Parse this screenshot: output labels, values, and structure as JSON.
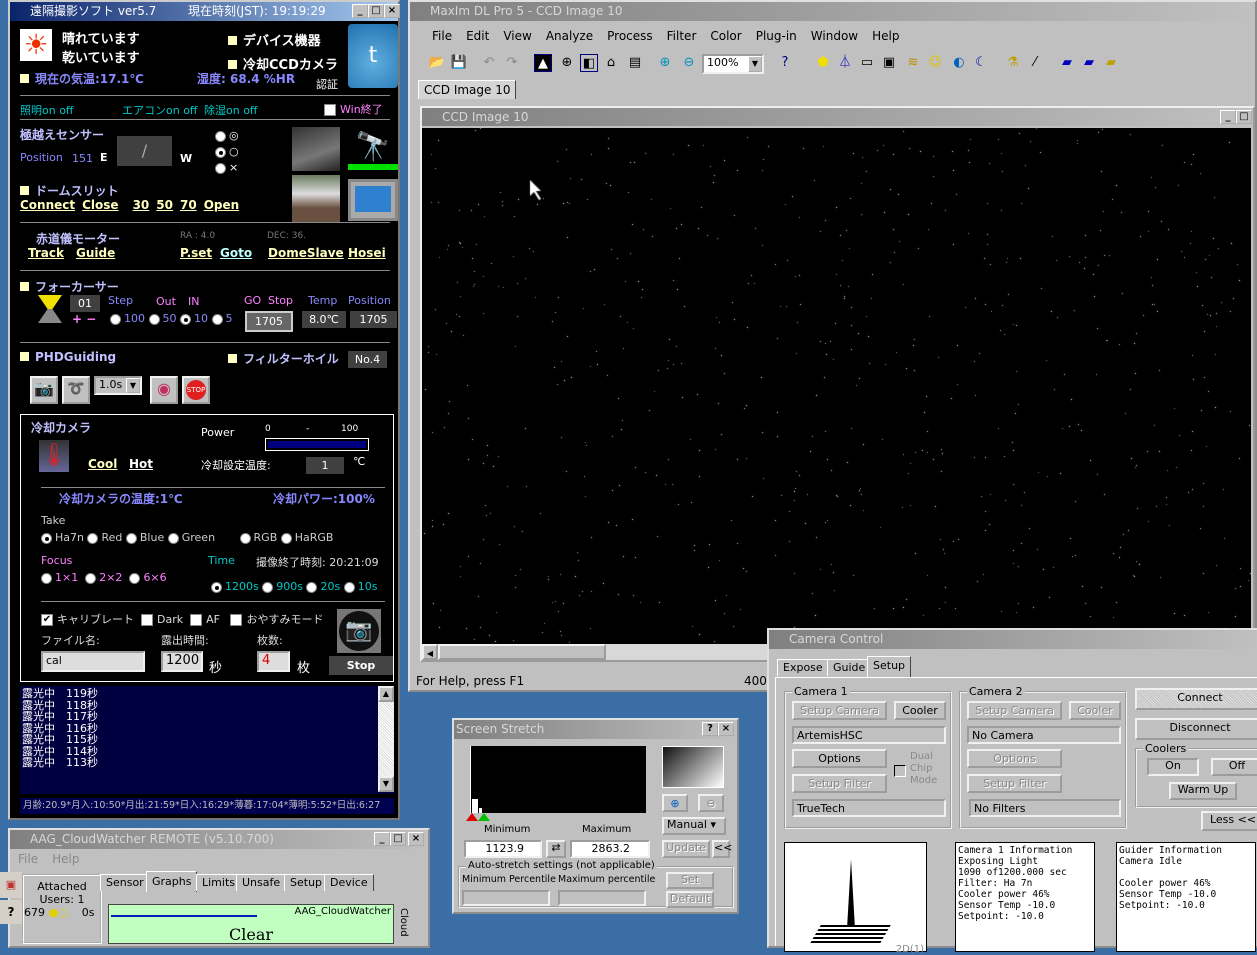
{
  "left_app": {
    "title": "遠隔撮影ソフト ver5.7",
    "clock": "現在時刻(JST): 19:19:29",
    "weather1": "晴れています",
    "weather2": "乾いています",
    "device": "デバイス機器",
    "ccd": "冷却CCDカメラ",
    "temp": "現在の気温:17.1℃",
    "humidity": "湿度: 68.4 %HR",
    "auth": "認証",
    "light": "照明on off",
    "aircon": "エアコンon  off",
    "dehumid": "除湿on off",
    "win_exit": "Win終了",
    "meridian_sensor": "極越えセンサー",
    "position_label": "Position",
    "position_value": "151",
    "east": "E",
    "west": "W",
    "sym1": "◎",
    "sym2": "○",
    "sym3": "×",
    "dome_slit": "ドームスリット",
    "dome_links": [
      "Connect",
      "Close",
      "30",
      "50",
      "70",
      "Open"
    ],
    "mount": "赤道儀モーター",
    "ra": "RA : 4.0",
    "dec": "DEC: 36.",
    "mount_links": [
      "Track",
      "Guide",
      "P.set",
      "Goto",
      "DomeSlave",
      "Hosei"
    ],
    "focuser": "フォーカーサー",
    "focus_id": "01",
    "step": "Step",
    "out": "Out",
    "in": "IN",
    "plusminus": "+ −",
    "steps": [
      "100",
      "50",
      "10",
      "5"
    ],
    "go": "GO",
    "stop": "Stop",
    "temp_label": "Temp",
    "position2": "Position",
    "go_value": "1705",
    "temp_value": "8.0℃",
    "pos_value": "1705",
    "phd": "PHDGuiding",
    "filter_wheel": "フィルターホイル",
    "filter_no": "No.4",
    "phd_exposure": "1.0s",
    "cool_cam": "冷却カメラ",
    "power": "Power",
    "power_min": "0",
    "power_dash": "-",
    "power_max": "100",
    "power_pct": 100,
    "cool": "Cool",
    "hot": "Hot",
    "set_temp_label": "冷却設定温度:",
    "set_temp": "1",
    "deg": "℃",
    "cam_temp": "冷却カメラの温度:1℃",
    "cool_power": "冷却パワー:100%",
    "take": "Take",
    "filters": [
      "Ha7n",
      "Red",
      "Blue",
      "Green",
      "RGB",
      "HaRGB"
    ],
    "focus": "Focus",
    "bins": [
      "1×1",
      "2×2",
      "6×6"
    ],
    "time": "Time",
    "end_time": "撮像終了時刻:  20:21:09",
    "times": [
      "1200s",
      "900s",
      "20s",
      "10s"
    ],
    "calib": "キャリブレート",
    "dark": "Dark",
    "af": "AF",
    "sleep": "おやすみモード",
    "filename_label": "ファイル名:",
    "filename": "cal",
    "exp_label": "露出時間:",
    "exp": "1200",
    "sec": "秒",
    "count_label": "枚数:",
    "count": "4",
    "count_unit": "枚",
    "stop_btn": "Stop",
    "log": [
      "露光中　119秒",
      "露光中　118秒",
      "露光中　117秒",
      "露光中　116秒",
      "露光中　115秒",
      "露光中　114秒",
      "露光中　113秒"
    ],
    "astro": "月齢:20.9*月入:10:50*月出:21:59*日入:16:29*薄暮:17:04*薄明:5:52*日出:6:27"
  },
  "maxim": {
    "title": "MaxIm DL Pro 5 - CCD Image 10",
    "menu": [
      "File",
      "Edit",
      "View",
      "Analyze",
      "Process",
      "Filter",
      "Color",
      "Plug-in",
      "Window",
      "Help"
    ],
    "zoom": "100%",
    "doc_tab": "CCD Image 10",
    "child_title": "CCD Image 10",
    "status": "For Help, press F1",
    "status_right": "400"
  },
  "stretch": {
    "title": "Screen Stretch",
    "min_label": "Minimum",
    "max_label": "Maximum",
    "min": "1123.9",
    "max": "2863.2",
    "mode": "Manual",
    "update": "Update",
    "collapse": "<<",
    "auto": "Auto-stretch settings (not applicable)",
    "min_pct": "Minimum Percentile",
    "max_pct": "Maximum percentile",
    "set": "Set",
    "default": "Default"
  },
  "camera": {
    "title": "Camera Control",
    "tabs": [
      "Expose",
      "Guide",
      "Setup"
    ],
    "cam1": "Camera 1",
    "cam2": "Camera 2",
    "setup_camera": "Setup Camera",
    "cooler": "Cooler",
    "cam1_name": "ArtemisHSC",
    "cam2_name": "No Camera",
    "options": "Options",
    "setup_filter": "Setup Filter",
    "dual": "Dual Chip Mode",
    "filter1": "TrueTech",
    "filter2": "No Filters",
    "connect": "Connect",
    "disconnect": "Disconnect",
    "coolers": "Coolers",
    "on": "On",
    "off": "Off",
    "warm": "Warm Up",
    "less": "Less <<",
    "plot_label": "2D(1)",
    "info1": "Camera 1 Information\nExposing Light\n1090 of1200.000 sec\nFilter: Ha 7n\nCooler power 46%\nSensor Temp -10.0\nSetpoint: -10.0",
    "info2": "Guider Information\nCamera Idle\n\nCooler power 46%\nSensor Temp -10.0\nSetpoint: -10.0"
  },
  "cloud": {
    "title": "AAG_CloudWatcher REMOTE (v5.10.700)",
    "menu": [
      "File",
      "Help"
    ],
    "attached": "Attached",
    "users": "Users: 1",
    "count": "679",
    "secs": "0s",
    "tabs": [
      "Sensor",
      "Graphs",
      "Limits",
      "Unsafe",
      "Setup",
      "Device"
    ],
    "graph_label": "AAG_CloudWatcher",
    "state": "Clear",
    "side": "Cloud"
  }
}
